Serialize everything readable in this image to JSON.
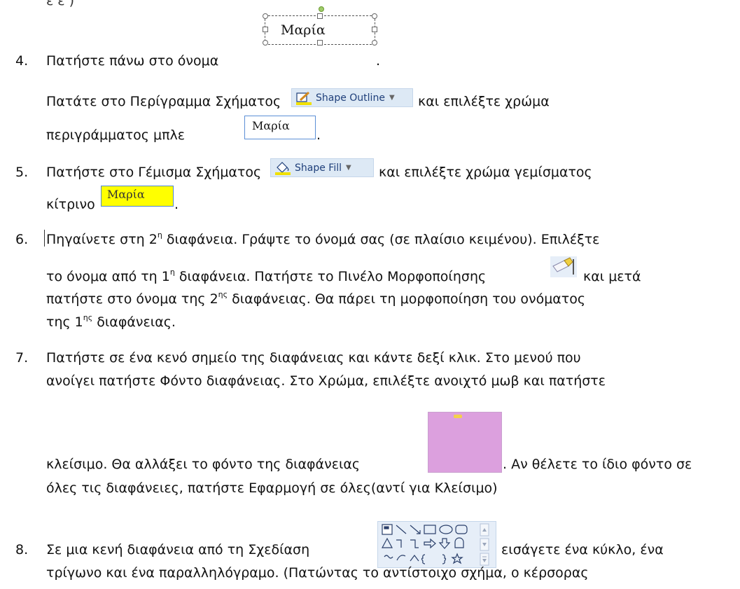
{
  "name_box_text": "Μαρία",
  "step4": {
    "number": "4.",
    "text": "Πατήστε πάνω στο όνομα",
    "end": ".",
    "line2_before": "Πατάτε στο Περίγραμμα Σχήματος",
    "shape_outline_label": "Shape Outline",
    "line2_after": "και επιλέξτε χρώμα",
    "line3_before": "περιγράμματος μπλε",
    "line3_end": "."
  },
  "step5": {
    "number": "5.",
    "before": "Πατήστε στο Γέμισμα Σχήματος",
    "shape_fill_label": "Shape Fill",
    "after": "και επιλέξτε χρώμα γεμίσματος",
    "line2_before": "κίτρινο",
    "line2_end": "."
  },
  "step6": {
    "number": "6.",
    "l1_a": "Πηγαίνετε στη 2",
    "l1_sup": "η",
    "l1_b": " διαφάνεια. Γράψτε το όνομά σας (σε πλαίσιο κειμένου). Επιλέξτε",
    "l2_a": "το όνομα από τη 1",
    "l2_sup": "η",
    "l2_b": " διαφάνεια. Πατήστε το Πινέλο Μορφοποίησης",
    "l2_c": "και μετά",
    "l3_a": "πατήστε στο όνομα της 2",
    "l3_sup": "ης",
    "l3_b": " διαφάνειας.  Θα πάρει τη μορφοποίηση του ονόματος",
    "l4_a": "της 1",
    "l4_sup": "ης",
    "l4_b": " διαφάνειας."
  },
  "step7": {
    "number": "7.",
    "l1": "Πατήστε σε ένα κενό σημείο της διαφάνειας και κάντε δεξί κλικ. Στο μενού που",
    "l2": "ανοίγει πατήστε Φόντο διαφάνειας.  Στο Χρώμα, επιλέξτε ανοιχτό μωβ και πατήστε",
    "l3_a": "κλείσιμο. Θα αλλάξει το φόντο της διαφάνειας",
    "l3_b": ". Αν θέλετε το ίδιο φόντο σε",
    "l4": "όλες τις διαφάνειες, πατήστε Εφαρμογή σε όλες(αντί για Κλείσιμο)"
  },
  "step8": {
    "number": "8.",
    "l1_a": "Σε μια κενή διαφάνεια από τη Σχεδίαση",
    "l1_b": "εισάγετε ένα κύκλο, ένα",
    "l2": "τρίγωνο και ένα παραλληλόγραμο. (Πατώντας το αντίστοιχο σχήμα, ο κέρσορας"
  },
  "colors": {
    "outline_blue": "#5b8fd6",
    "fill_yellow": "#ffff00",
    "slide_purple": "#dca0de"
  }
}
